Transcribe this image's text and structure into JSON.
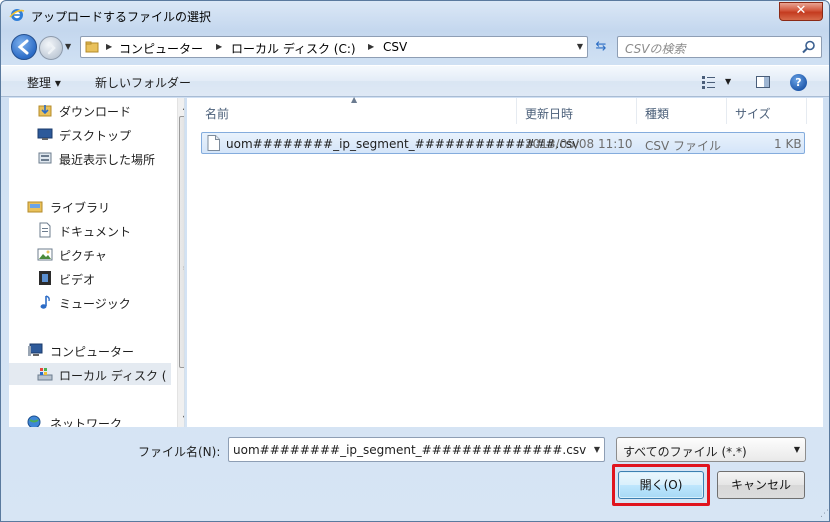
{
  "window": {
    "title": "アップロードするファイルの選択",
    "close_label": "✕"
  },
  "address_bar": {
    "breadcrumbs": [
      "コンピューター",
      "ローカル ディスク (C:)",
      "CSV"
    ],
    "search_placeholder": "CSVの検索"
  },
  "toolbar": {
    "organize_label": "整理 ▾",
    "new_folder_label": "新しいフォルダー",
    "help_label": "?"
  },
  "sidebar": {
    "items": [
      {
        "label": "ダウンロード",
        "icon": "download-folder-icon"
      },
      {
        "label": "デスクトップ",
        "icon": "desktop-icon"
      },
      {
        "label": "最近表示した場所",
        "icon": "recent-places-icon"
      },
      {
        "label": "ライブラリ",
        "icon": "libraries-icon"
      },
      {
        "label": "ドキュメント",
        "icon": "documents-icon"
      },
      {
        "label": "ピクチャ",
        "icon": "pictures-icon"
      },
      {
        "label": "ビデオ",
        "icon": "videos-icon"
      },
      {
        "label": "ミュージック",
        "icon": "music-icon"
      },
      {
        "label": "コンピューター",
        "icon": "computer-icon"
      },
      {
        "label": "ローカル ディスク (",
        "icon": "local-disk-icon",
        "selected": true
      },
      {
        "label": "ネットワーク",
        "icon": "network-icon"
      }
    ]
  },
  "file_list": {
    "columns": [
      "名前",
      "更新日時",
      "種類",
      "サイズ"
    ],
    "rows": [
      {
        "name": "uom########_ip_segment_##############.csv",
        "modified": "2013/05/08 11:10",
        "type": "CSV ファイル",
        "size": "1 KB",
        "selected": true
      }
    ]
  },
  "footer": {
    "filename_label": "ファイル名(N):",
    "filename_value": "uom########_ip_segment_##############.csv",
    "filetype_value": "すべてのファイル (*.*)",
    "open_label": "開く(O)",
    "cancel_label": "キャンセル"
  },
  "colors": {
    "highlight_border": "#e0141e",
    "selection_fill": "#d4e5f9",
    "selection_border": "#84acdd"
  }
}
